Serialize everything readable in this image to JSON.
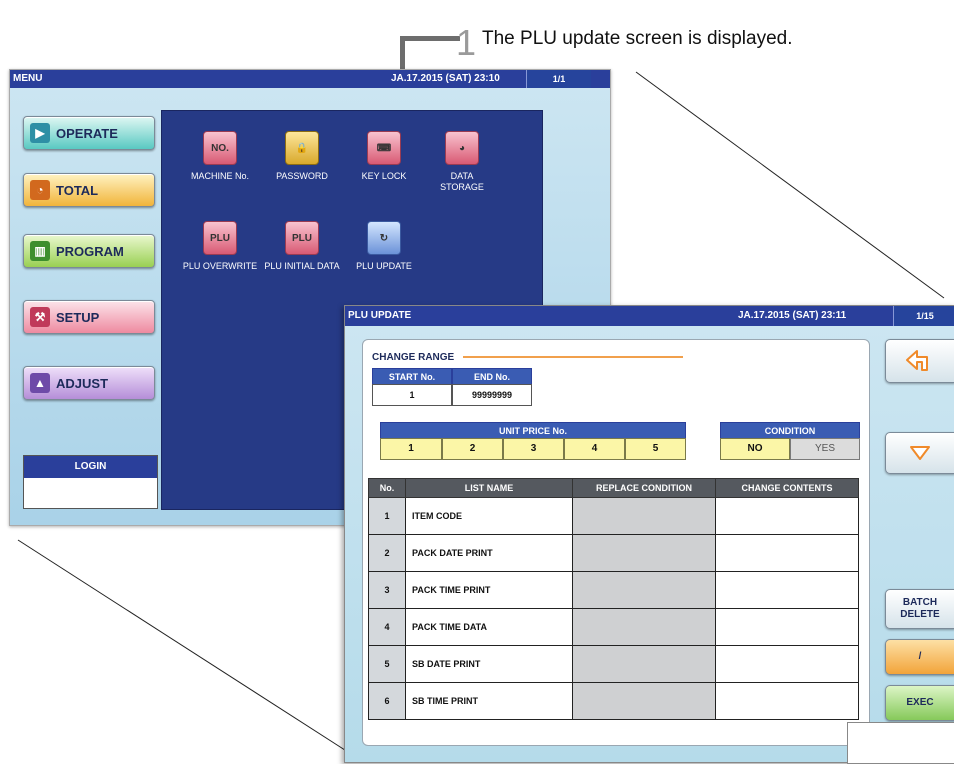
{
  "callout": {
    "number": "1",
    "text": "The PLU update screen is displayed."
  },
  "menu_screen": {
    "title": "MENU",
    "datetime": "JA.17.2015 (SAT)  23:10",
    "page": "1/1",
    "nav_buttons": [
      {
        "label": "OPERATE",
        "icon": "play-circle-icon"
      },
      {
        "label": "TOTAL",
        "icon": "clock-icon"
      },
      {
        "label": "PROGRAM",
        "icon": "book-icon"
      },
      {
        "label": "SETUP",
        "icon": "wrench-icon"
      },
      {
        "label": "ADJUST",
        "icon": "scale-icon"
      }
    ],
    "login": {
      "label": "LOGIN"
    },
    "icons": [
      {
        "label": "MACHINE No.",
        "glyph": "NO.",
        "icon": "machine-number-icon"
      },
      {
        "label": "PASSWORD",
        "glyph": "🔒",
        "icon": "padlock-icon"
      },
      {
        "label": "KEY LOCK",
        "glyph": "⌨",
        "icon": "key-lock-icon"
      },
      {
        "label": "DATA STORAGE",
        "glyph": "◕",
        "icon": "pie-chart-icon"
      },
      {
        "label": "PLU OVERWRITE",
        "glyph": "PLU",
        "icon": "plu-overwrite-icon"
      },
      {
        "label": "PLU INITIAL DATA",
        "glyph": "PLU",
        "icon": "plu-initial-data-icon"
      },
      {
        "label": "PLU UPDATE",
        "glyph": "↻",
        "icon": "plu-update-icon"
      }
    ]
  },
  "plu_screen": {
    "title": "PLU UPDATE",
    "datetime": "JA.17.2015 (SAT)  23:11",
    "page": "1/15",
    "change_range": {
      "label": "CHANGE RANGE",
      "start_label": "START No.",
      "end_label": "END No.",
      "start_value": "1",
      "end_value": "99999999"
    },
    "unit_price": {
      "label": "UNIT PRICE No.",
      "options": [
        "1",
        "2",
        "3",
        "4",
        "5"
      ]
    },
    "condition": {
      "label": "CONDITION",
      "no": "NO",
      "yes": "YES",
      "selected": "NO"
    },
    "table": {
      "headers": [
        "No.",
        "LIST NAME",
        "REPLACE CONDITION",
        "CHANGE CONTENTS"
      ],
      "rows": [
        {
          "no": "1",
          "name": "ITEM CODE"
        },
        {
          "no": "2",
          "name": "PACK DATE PRINT"
        },
        {
          "no": "3",
          "name": "PACK TIME PRINT"
        },
        {
          "no": "4",
          "name": "PACK TIME DATA"
        },
        {
          "no": "5",
          "name": "SB DATE PRINT"
        },
        {
          "no": "6",
          "name": "SB TIME PRINT"
        }
      ]
    },
    "side_buttons": {
      "back_icon": "back-arrow-icon",
      "down_icon": "down-triangle-icon",
      "batch_delete": "BATCH DELETE",
      "edit_glyph": "/",
      "exec": "EXEC"
    }
  }
}
